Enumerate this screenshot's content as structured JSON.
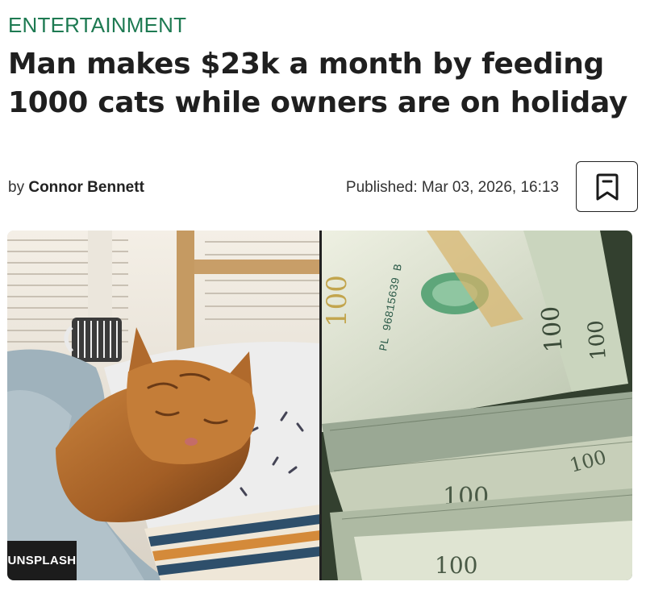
{
  "article": {
    "category": "ENTERTAINMENT",
    "headline": "Man makes $23k a month by feeding 1000 cats while owners are on holiday",
    "byline_prefix": "by",
    "author": "Connor Bennett",
    "published": "Published: Mar 03, 2026, 16:13"
  },
  "actions": {
    "bookmark_icon": "bookmark-icon"
  },
  "image": {
    "credit": "UNSPLASH",
    "left_panel": "orange tabby cat sleeping on a bed",
    "right_panel": "fanned stack of 100 dollar bills",
    "bill_denomination": "100"
  },
  "colors": {
    "category": "#1e7a52",
    "headline": "#1f1f1f",
    "credit_bg": "#1c1c1c"
  }
}
